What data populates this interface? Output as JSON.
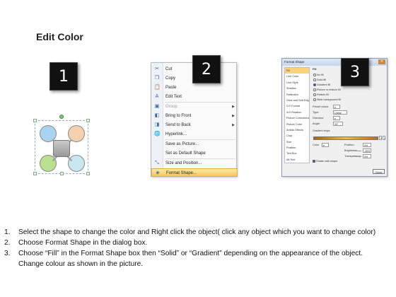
{
  "title": "Edit Color",
  "badges": [
    "1",
    "2",
    "3"
  ],
  "diagram": {
    "circle_colors": [
      "#a9d3f2",
      "#f6d0ae",
      "#b9e08c",
      "#c9e7f3"
    ],
    "center_color": "#b0b0b0"
  },
  "context_menu": {
    "items": [
      {
        "label": "Cut",
        "icon": "scissors-icon",
        "glyph": "✂",
        "state": "normal"
      },
      {
        "label": "Copy",
        "icon": "copy-icon",
        "glyph": "❐",
        "state": "normal"
      },
      {
        "label": "Paste",
        "icon": "paste-icon",
        "glyph": "📋",
        "state": "normal"
      },
      {
        "label": "Edit Text",
        "icon": "edit-text-icon",
        "glyph": "A",
        "state": "normal"
      },
      {
        "label": "Group",
        "icon": "group-icon",
        "glyph": "▣",
        "state": "disabled",
        "submenu": true
      },
      {
        "label": "Bring to Front",
        "icon": "bring-front-icon",
        "glyph": "◧",
        "state": "normal",
        "submenu": true
      },
      {
        "label": "Send to Back",
        "icon": "send-back-icon",
        "glyph": "◨",
        "state": "normal",
        "submenu": true
      },
      {
        "label": "Hyperlink...",
        "icon": "hyperlink-icon",
        "glyph": "🌐",
        "state": "normal"
      },
      {
        "label": "Save as Picture...",
        "icon": "",
        "glyph": "",
        "state": "normal"
      },
      {
        "label": "Set as Default Shape",
        "icon": "",
        "glyph": "",
        "state": "normal"
      },
      {
        "label": "Size and Position...",
        "icon": "size-position-icon",
        "glyph": "⤡",
        "state": "normal"
      },
      {
        "label": "Format Shape...",
        "icon": "format-shape-icon",
        "glyph": "◈",
        "state": "highlighted"
      }
    ]
  },
  "format_dialog": {
    "title": "Format Shape",
    "categories": [
      "Fill",
      "Line Color",
      "Line Style",
      "Shadow",
      "Reflection",
      "Glow and Soft Edges",
      "3-D Format",
      "3-D Rotation",
      "Picture Corrections",
      "Picture Color",
      "Artistic Effects",
      "Crop",
      "Size",
      "Position",
      "Text Box",
      "Alt Text"
    ],
    "section": "Fill",
    "fill_options": [
      "No fill",
      "Solid fill",
      "Gradient fill",
      "Picture or texture fill",
      "Pattern fill",
      "Slide background fill"
    ],
    "preset_label": "Preset colors:",
    "type_label": "Type:",
    "type_value": "Linear",
    "direction_label": "Direction:",
    "angle_label": "Angle:",
    "angle_value": "90°",
    "stops_label": "Gradient stops",
    "color_label": "Color",
    "position_label": "Position:",
    "position_value": "0%",
    "brightness_label": "Brightness:",
    "brightness_value": "-30%",
    "transparency_label": "Transparency:",
    "transparency_value": "0%",
    "rotate_label": "Rotate with shape",
    "close_label": "Close"
  },
  "steps": [
    {
      "num": "1.",
      "text": "Select the shape to change the color and Right click the object( click any object which you want to change color)"
    },
    {
      "num": "2.",
      "text": "Choose Format Shape in the dialog box."
    },
    {
      "num": "3.",
      "text": "Choose “Fill” in the Format Shape box then “Solid” or “Gradient” depending on the appearance of the object. Change colour as shown in the picture."
    }
  ]
}
